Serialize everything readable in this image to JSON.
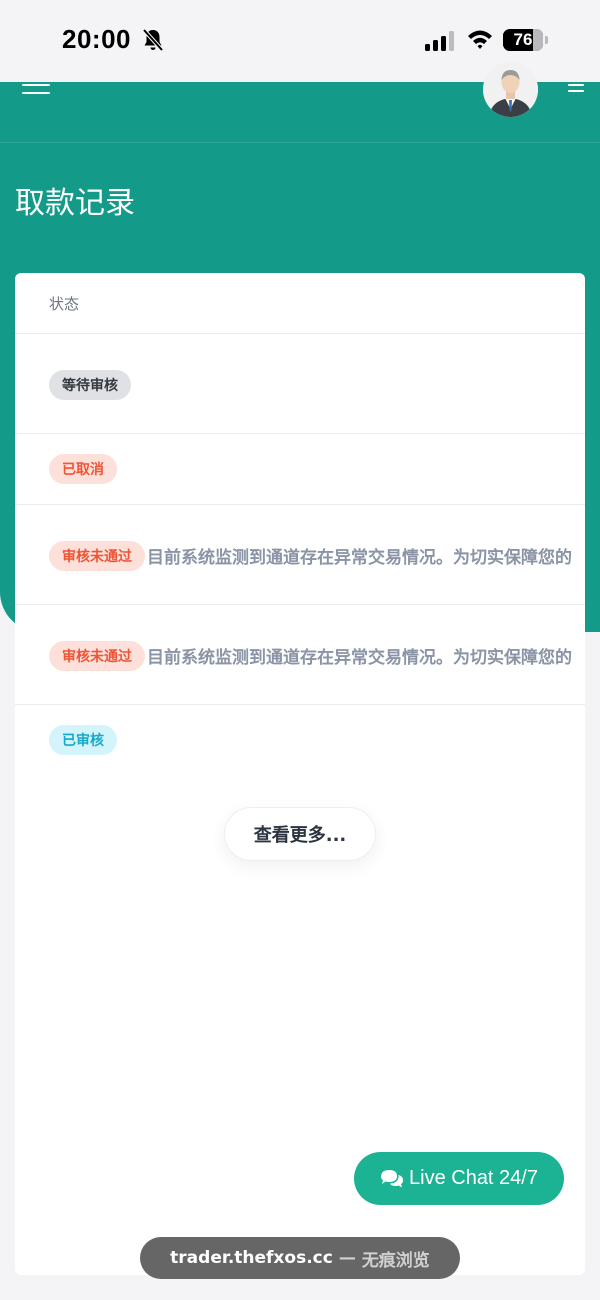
{
  "status_bar": {
    "time": "20:00",
    "battery_level": "76",
    "battery_fraction": 0.76,
    "icons": [
      "bell-muted-icon",
      "signal-icon",
      "wifi-icon",
      "battery-icon"
    ]
  },
  "header": {
    "menu_icon": "hamburger-menu-icon",
    "avatar": "user-avatar",
    "more_icon": "menu-lines-icon",
    "title": "取款记录"
  },
  "table": {
    "column_header": "状态",
    "rows": [
      {
        "status": "等待审核",
        "status_type": "pending",
        "reason": ""
      },
      {
        "status": "已取消",
        "status_type": "cancelled",
        "reason": ""
      },
      {
        "status": "审核未通过",
        "status_type": "rejected",
        "reason": "目前系统监测到通道存在异常交易情况。为切实保障您的"
      },
      {
        "status": "审核未通过",
        "status_type": "rejected",
        "reason": "目前系统监测到通道存在异常交易情况。为切实保障您的"
      },
      {
        "status": "已审核",
        "status_type": "approved",
        "reason": ""
      }
    ],
    "more_button": "查看更多..."
  },
  "live_chat": {
    "label": "Live Chat 24/7",
    "icon": "chat-bubbles-icon"
  },
  "browser": {
    "host": "trader.thefxos.cc",
    "separator": "—",
    "mode": "无痕浏览"
  },
  "colors": {
    "header_teal": "#149a88",
    "live_chat_green": "#1cb394",
    "badge_danger": "#f05435",
    "badge_info": "#17a9c9"
  }
}
